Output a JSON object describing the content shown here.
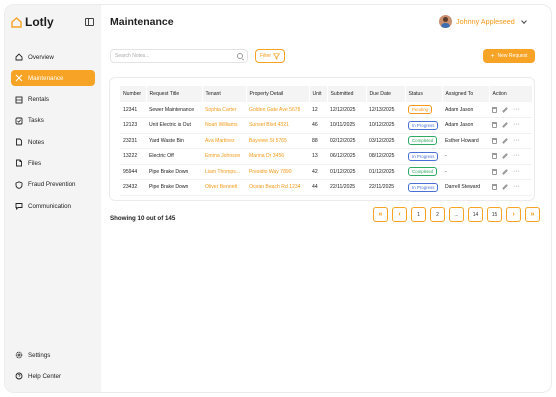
{
  "app": {
    "name": "Lotly"
  },
  "colors": {
    "accent": "#f7a325",
    "pending": "#f39a1a",
    "in_progress": "#4a6fd6",
    "completed": "#2eaa63"
  },
  "sidebar": {
    "items": [
      {
        "label": "Overview",
        "icon": "home-icon"
      },
      {
        "label": "Maintenance",
        "icon": "tools-icon",
        "active": true
      },
      {
        "label": "Rentals",
        "icon": "building-icon"
      },
      {
        "label": "Tasks",
        "icon": "checklist-icon"
      },
      {
        "label": "Notes",
        "icon": "note-icon"
      },
      {
        "label": "Files",
        "icon": "file-icon"
      },
      {
        "label": "Fraud Prevention",
        "icon": "shield-icon"
      },
      {
        "label": "Communication",
        "icon": "chat-icon"
      }
    ],
    "bottom": [
      {
        "label": "Settings",
        "icon": "gear-icon"
      },
      {
        "label": "Help Center",
        "icon": "help-icon"
      }
    ]
  },
  "header": {
    "title": "Maintenance",
    "user_name": "Johnny Appleseed"
  },
  "toolbar": {
    "search_placeholder": "Search Notes...",
    "filter_label": "Filter",
    "new_request_label": "New Request"
  },
  "table": {
    "columns": [
      "Number",
      "Request Title",
      "Tenant",
      "Property Detail",
      "Unit",
      "Submitted",
      "Due Date",
      "Status",
      "Assigned To",
      "Action"
    ],
    "rows": [
      {
        "number": "12341",
        "title": "Sewer Maintenance",
        "tenant": "Sophia Carter",
        "property": "Golden Gate Ave 5678",
        "unit": "12",
        "submitted": "12/12/2025",
        "due": "12/13/2025",
        "status": "Pending",
        "status_key": "pending",
        "assigned": "Adam Jason"
      },
      {
        "number": "12123",
        "title": "Unit Electric is Out",
        "tenant": "Noah Williams",
        "property": "Sunset Blvd 4321",
        "unit": "46",
        "submitted": "10/11/2025",
        "due": "10/12/2025",
        "status": "In Progress",
        "status_key": "in_progress",
        "assigned": "Adam Jason"
      },
      {
        "number": "23231",
        "title": "Yard Waste Bin",
        "tenant": "Ava Martinez",
        "property": "Bayview St 5765",
        "unit": "88",
        "submitted": "02/12/2025",
        "due": "03/12/2025",
        "status": "Completed",
        "status_key": "completed",
        "assigned": "Esther Howard"
      },
      {
        "number": "13222",
        "title": "Electric Off",
        "tenant": "Emma Johnson",
        "property": "Marina Dr 3456",
        "unit": "13",
        "submitted": "06/12/2025",
        "due": "08/12/2025",
        "status": "In Progress",
        "status_key": "in_progress",
        "assigned": "-"
      },
      {
        "number": "95944",
        "title": "Pipe Brake Down",
        "tenant": "Liam Thomps...",
        "property": "Presidio Way 7890",
        "unit": "42",
        "submitted": "01/12/2025",
        "due": "01/12/2025",
        "status": "Completed",
        "status_key": "completed",
        "assigned": "-"
      },
      {
        "number": "23432",
        "title": "Pipe Brake Down",
        "tenant": "Oliver Bennett",
        "property": "Ocean Beach Rd 1234",
        "unit": "44",
        "submitted": "22/11/2025",
        "due": "22/11/2025",
        "status": "In Progress",
        "status_key": "in_progress",
        "assigned": "Darrell Steward"
      }
    ]
  },
  "footer": {
    "showing": "Showing 10 out of 145",
    "pages": [
      "«",
      "‹",
      "1",
      "2",
      "...",
      "14",
      "15",
      "›",
      "»"
    ]
  }
}
